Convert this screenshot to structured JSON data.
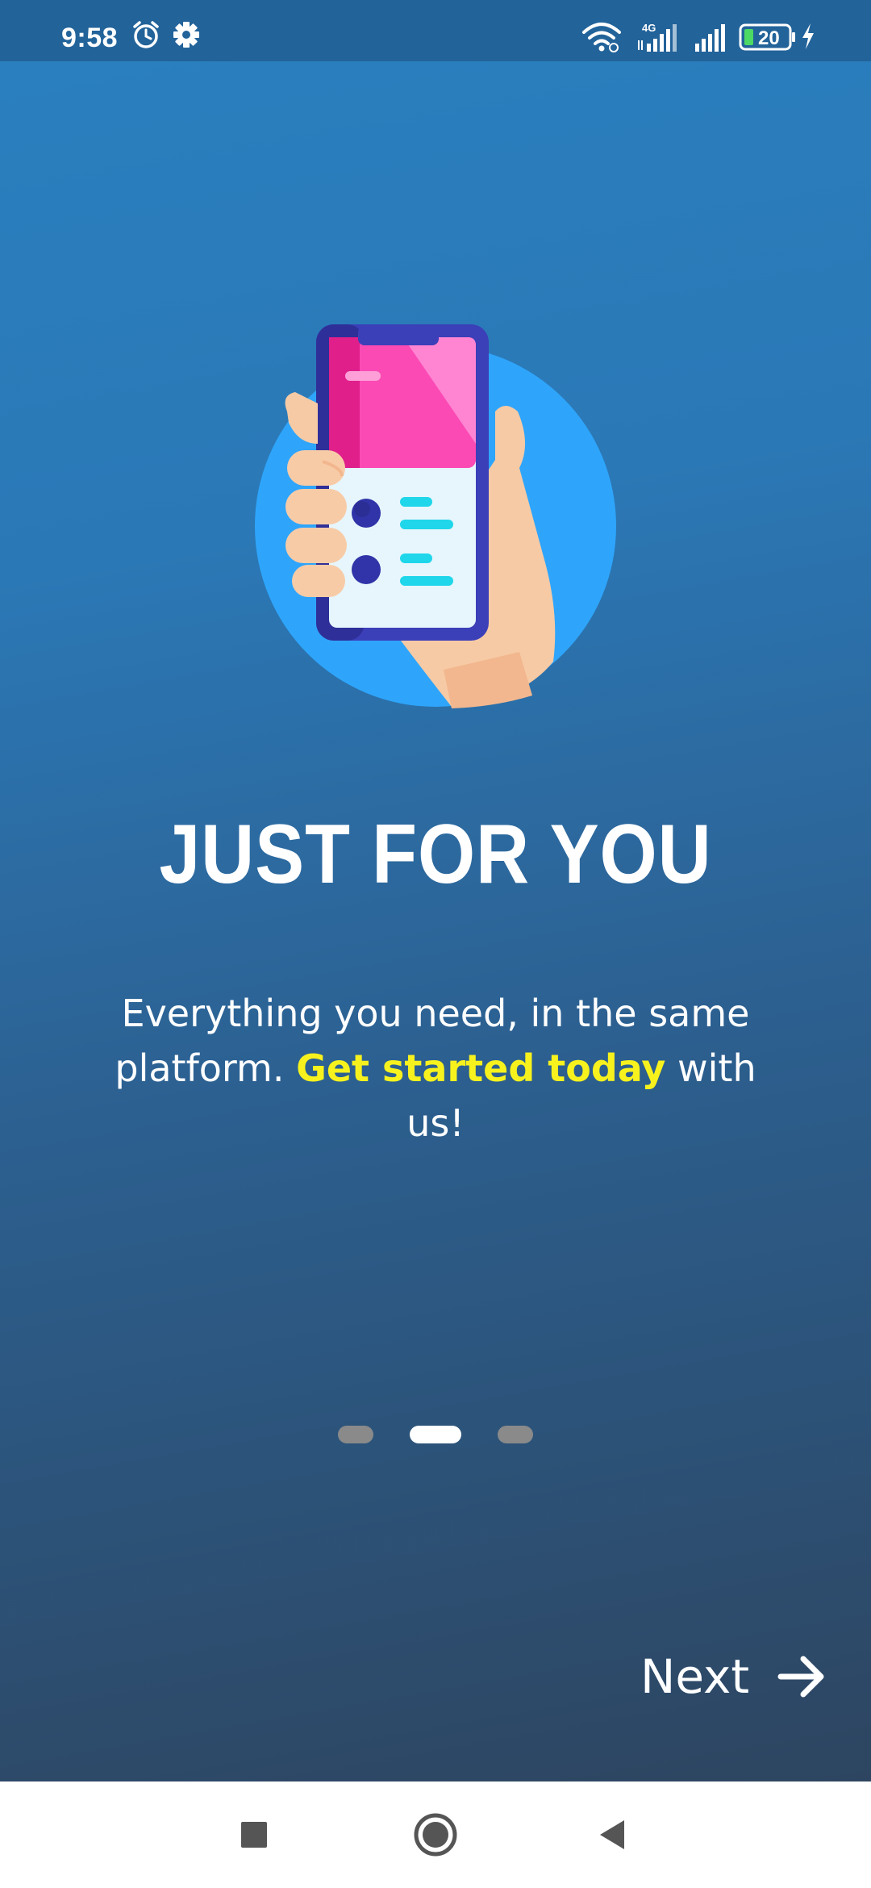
{
  "status_bar": {
    "time": "9:58",
    "network_label": "4G",
    "battery_level": "20",
    "icons": [
      "alarm-icon",
      "settings-gear-icon",
      "wifi-icon",
      "signal-4g-icon",
      "signal-icon",
      "battery-icon",
      "charging-bolt-icon"
    ]
  },
  "onboarding": {
    "title": "JUST FOR YOU",
    "subtitle_before": "Everything you need, in the same platform. ",
    "subtitle_highlight": "Get started today",
    "subtitle_after": " with us!",
    "page_count": 3,
    "active_page": 2,
    "illustration_icon": "hand-holding-phone-illustration"
  },
  "actions": {
    "next_label": "Next",
    "next_icon": "arrow-right-icon"
  },
  "nav_bar": {
    "recents_icon": "square-recents-icon",
    "home_icon": "circle-home-icon",
    "back_icon": "triangle-back-icon"
  },
  "colors": {
    "highlight": "#f7f21d",
    "status_bar": "#22639a",
    "indicator_active": "#ffffff",
    "indicator_inactive": "#8a8a8a"
  }
}
